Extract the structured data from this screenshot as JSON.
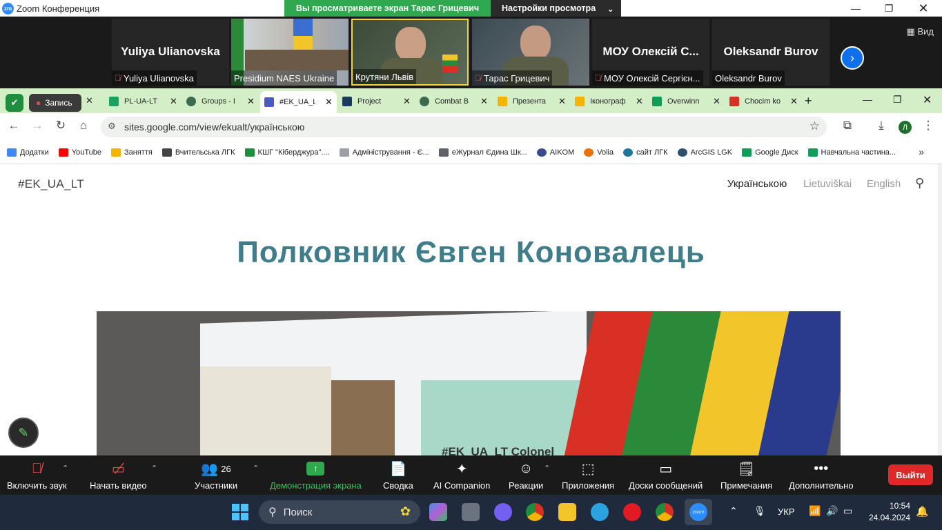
{
  "zoom": {
    "window_title": "Zoom Конференция",
    "share_banner": "Вы просматриваете экран Тарас Грицевич",
    "view_options": "Настройки просмотра",
    "view_button": "Вид",
    "participants": [
      {
        "big_name": "Yuliya Ulianovska",
        "label": "Yuliya Ulianovska",
        "muted": true
      },
      {
        "big_name": "",
        "label": "Presidium NAES Ukraine",
        "muted": false
      },
      {
        "big_name": "",
        "label": "Крутяни Львів",
        "muted": false
      },
      {
        "big_name": "",
        "label": "Тарас Грицевич",
        "muted": true
      },
      {
        "big_name": "МОУ  Олексій С...",
        "label": "МОУ Олексій Сергієн...",
        "muted": true
      },
      {
        "big_name": "Oleksandr Burov",
        "label": "Oleksandr Burov",
        "muted": false
      }
    ],
    "controls": {
      "unmute": "Включить звук",
      "start_video": "Начать видео",
      "participants": "Участники",
      "participants_count": "26",
      "share_screen": "Демонстрация экрана",
      "summary": "Сводка",
      "ai_companion": "AI Companion",
      "reactions": "Реакции",
      "apps": "Приложения",
      "whiteboards": "Доски сообщений",
      "notes": "Примечания",
      "more": "Дополнительно",
      "leave": "Выйти"
    }
  },
  "chrome": {
    "record_label": "Запись",
    "tabs": [
      {
        "title": "PL-UA-LT",
        "color": "#1aa260"
      },
      {
        "title": "Groups - I",
        "color": "#3d6b4f"
      },
      {
        "title": "#EK_UA_L",
        "color": "#4a5bbf"
      },
      {
        "title": "Project",
        "color": "#1b3a5c"
      },
      {
        "title": "Combat B",
        "color": "#3d6b4f"
      },
      {
        "title": "Презента",
        "color": "#f4b400"
      },
      {
        "title": "Іконограф",
        "color": "#f4b400"
      },
      {
        "title": "Overwinn",
        "color": "#0f9d58"
      },
      {
        "title": "Chocim ko",
        "color": "#d93025"
      }
    ],
    "url": "sites.google.com/view/ekualt/українською",
    "bookmarks": [
      {
        "label": "Додатки",
        "color": "#4285f4"
      },
      {
        "label": "YouTube",
        "color": "#ff0000"
      },
      {
        "label": "Заняття",
        "color": "#f4b400"
      },
      {
        "label": "Вчительська ЛГК",
        "color": "#444444"
      },
      {
        "label": "КШГ \"Кіберджура\"....",
        "color": "#1e8e3e"
      },
      {
        "label": "Адміністрування - Є...",
        "color": "#9aa0a6"
      },
      {
        "label": "eЖурнал Єдина Шк...",
        "color": "#5f6368"
      },
      {
        "label": "AIKOM",
        "color": "#3c4a8c"
      },
      {
        "label": "Volia",
        "color": "#e8710a"
      },
      {
        "label": "сайт ЛГК",
        "color": "#21759b"
      },
      {
        "label": "ArcGIS LGK",
        "color": "#2d4f6b"
      },
      {
        "label": "Google Диск",
        "color": "#0f9d58"
      },
      {
        "label": "Навчальна частина...",
        "color": "#0f9d58"
      }
    ]
  },
  "site": {
    "title": "#EK_UA_LT",
    "nav": [
      "Українською",
      "Lietuviškai",
      "English"
    ],
    "headline": "Полковник Євген Коновалець",
    "hero_caption": "#EK_UA_LT Colonel"
  },
  "taskbar": {
    "search_placeholder": "Поиск",
    "lang": "УКР",
    "time": "10:54",
    "date": "24.04.2024"
  },
  "colors": {
    "headline": "#3f7d8a",
    "share_green": "#2fa84f",
    "leave_red": "#e02828",
    "chrome_theme": "#d4efc8"
  }
}
